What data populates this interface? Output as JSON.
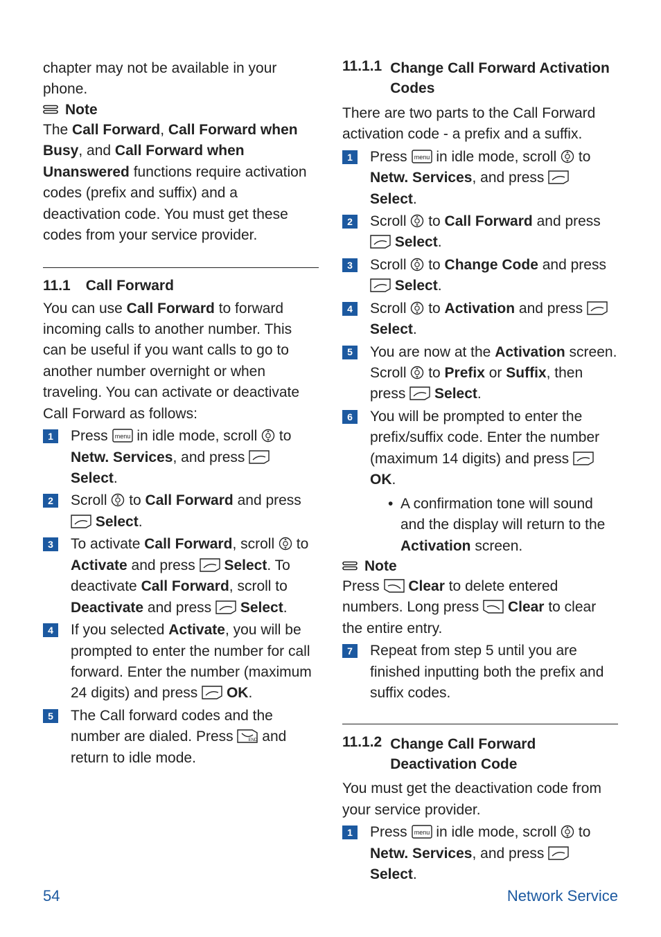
{
  "noteLabel": "Note",
  "pageNumber": "54",
  "footerLabel": "Network Service",
  "left": {
    "intro": "chapter may not be available in your phone.",
    "noteBody_html": "The <b>Call Forward</b>, <b>Call Forward when Busy</b>, and <b>Call Forward when Unanswered</b> functions require activation codes (prefix and suffix) and a deactivation code. You must get these codes from your service provider.",
    "sec": {
      "num": "11.1",
      "title": "Call Forward"
    },
    "secIntro_html": "You can use <b>Call Forward</b> to forward incoming calls to another number. This can be useful if you want calls to go to another number overnight or when traveling. You can activate or deactivate Call Forward as follows:",
    "steps": [
      "Press {MENU} in idle mode, scroll {NAV} to <b>Netw. Services</b>, and press {SOFT} <b>Select</b>.",
      "Scroll {NAV} to <b>Call Forward</b> and press {SOFT} <b>Select</b>.",
      "To activate <b>Call Forward</b>, scroll {NAV} to <b>Activate</b> and press {SOFT} <b>Select</b>. To deactivate <b>Call Forward</b>, scroll to <b>Deactivate</b> and press {SOFT} <b>Select</b>.",
      "If you selected <b>Activate</b>, you will be prompted to enter the number for call forward. Enter the number (maximum 24 digits) and press {SOFT} <b>OK</b>.",
      "The Call forward codes and the number are dialed. Press {END} and return to idle mode."
    ]
  },
  "right": {
    "sub1": {
      "num": "11.1.1",
      "title": "Change Call Forward Activation Codes"
    },
    "sub1Intro": "There are two parts to the Call Forward activation code - a prefix and a suffix.",
    "sub1Steps": [
      "Press {MENU} in idle mode, scroll {NAV} to <b>Netw. Services</b>, and press {SOFT} <b>Select</b>.",
      "Scroll {NAV} to <b>Call Forward</b> and press {SOFT} <b>Select</b>.",
      "Scroll {NAV} to <b>Change Code</b> and press {SOFT} <b>Select</b>.",
      "Scroll {NAV} to <b>Activation</b> and press {SOFT} <b>Select</b>.",
      "You are now at the <b>Activation</b> screen. Scroll {NAV} to <b>Prefix</b> or <b>Suffix</b>, then press {SOFT} <b>Select</b>.",
      "You will be prompted to enter the prefix/suffix code. Enter the number (maximum 14 digits) and press {SOFT} <b>OK</b>."
    ],
    "sub1Bullet": "A confirmation tone will sound and the display will return to the <b>Activation</b> screen.",
    "noteBody_html": "Press {SOFTR} <b>Clear</b> to delete entered numbers. Long press {SOFTR} <b>Clear</b> to clear the entire entry.",
    "sub1Step7": "Repeat from step 5 until you are finished inputting both the prefix and suffix codes.",
    "sub2": {
      "num": "11.1.2",
      "title": "Change Call Forward Deactivation Code"
    },
    "sub2Intro": "You must get the deactivation code from your service provider.",
    "sub2Steps": [
      "Press {MENU} in idle mode, scroll {NAV} to <b>Netw. Services</b>, and press {SOFT} <b>Select</b>."
    ]
  }
}
